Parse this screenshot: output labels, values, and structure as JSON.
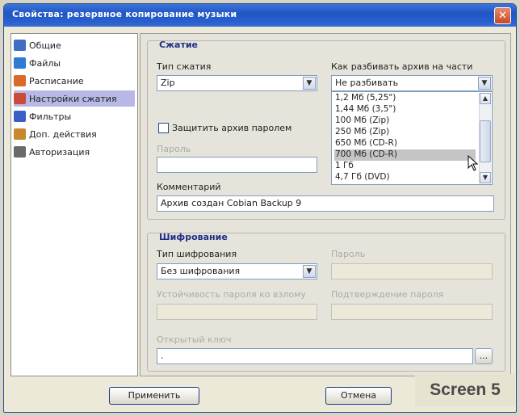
{
  "window": {
    "title": "Свойства: резервное копирование музыки",
    "close_label": "✕"
  },
  "sidebar": {
    "items": [
      {
        "label": "Общие",
        "icon": "general-icon",
        "color": "#3f6ec2"
      },
      {
        "label": "Файлы",
        "icon": "files-icon",
        "color": "#2e7cd6"
      },
      {
        "label": "Расписание",
        "icon": "schedule-icon",
        "color": "#d96a2a"
      },
      {
        "label": "Настройки сжатия",
        "icon": "compression-icon",
        "color": "#c94b3a",
        "selected": true
      },
      {
        "label": "Фильтры",
        "icon": "filters-icon",
        "color": "#3c5fc4"
      },
      {
        "label": "Доп. действия",
        "icon": "actions-icon",
        "color": "#c7882e"
      },
      {
        "label": "Авторизация",
        "icon": "auth-icon",
        "color": "#6a6a6a"
      }
    ]
  },
  "compression": {
    "group_title": "Сжатие",
    "type_label": "Тип сжатия",
    "type_value": "Zip",
    "split_label": "Как разбивать архив на части",
    "split_value": "Не разбивать",
    "split_options": [
      "1,2 Мб (5,25\")",
      "1,44 Мб (3,5\")",
      "100 Мб (Zip)",
      "250 Мб (Zip)",
      "650 Мб (CD-R)",
      "700 Мб (CD-R)",
      "1 Гб",
      "4,7 Гб (DVD)"
    ],
    "split_highlighted": "700 Мб (CD-R)",
    "protect_label": "Защитить архив паролем",
    "protect_checked": false,
    "password_label": "Пароль",
    "password_value": "",
    "comment_label": "Комментарий",
    "comment_value": "Архив создан Cobian Backup 9"
  },
  "encryption": {
    "group_title": "Шифрование",
    "type_label": "Тип шифрования",
    "type_value": "Без шифрования",
    "password_label": "Пароль",
    "strength_label": "Устойчивость пароля ко взлому",
    "confirm_label": "Подтверждение пароля",
    "public_key_label": "Открытый ключ",
    "public_key_value": ".",
    "browse_label": "..."
  },
  "buttons": {
    "apply": "Применить",
    "cancel": "Отмена"
  },
  "watermark": "Screen 5"
}
